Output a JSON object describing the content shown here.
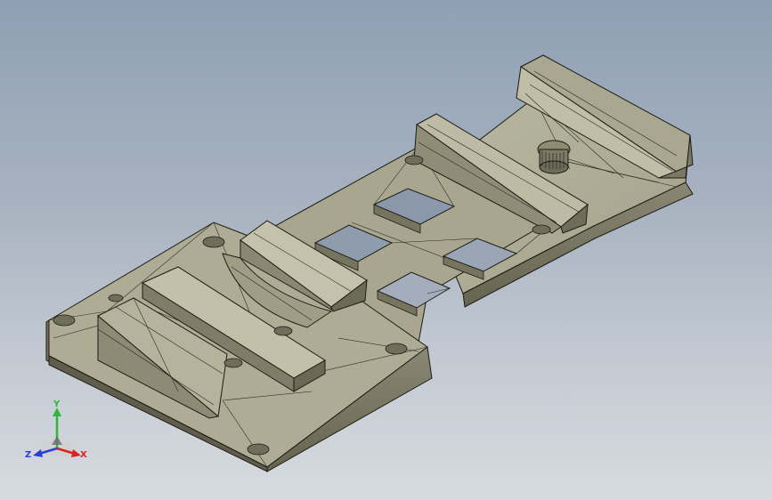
{
  "viewport": {
    "background_top": "#8fa0b4",
    "background_bottom": "#d7dbe1"
  },
  "model": {
    "face_color_light": "#b7b59d",
    "face_color_mid": "#9d9b83",
    "face_color_dark": "#6f6e5c",
    "edge_color": "#1c1c16"
  },
  "triad": {
    "x_label": "X",
    "y_label": "Y",
    "z_label": "Z",
    "x_color": "#d8231e",
    "y_color": "#2eb83a",
    "z_color": "#2a3fd6"
  }
}
